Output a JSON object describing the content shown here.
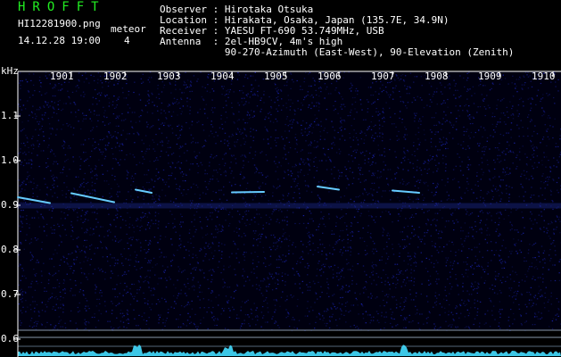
{
  "app": {
    "title": "HROFFT"
  },
  "file": {
    "name": "HI12281900.png",
    "datetime": "14.12.28 19:00"
  },
  "meteor": {
    "label": "meteor",
    "count": "4"
  },
  "info": {
    "observer": "Observer : Hirotaka Otsuka",
    "location": "Location : Hirakata, Osaka, Japan (135.7E, 34.9N)",
    "receiver": "Receiver : YAESU FT-690 53.749MHz, USB",
    "antenna": "Antenna  : 2el-HB9CV, 4m's high",
    "antenna2": "           90-270-Azimuth (East-West), 90-Elevation (Zenith)"
  },
  "axis": {
    "unit": "kHz",
    "x_labels": [
      "1901",
      "1902",
      "1903",
      "1904",
      "1905",
      "1906",
      "1907",
      "1908",
      "1909",
      "1910"
    ],
    "y_labels": [
      "1.1",
      "1.0",
      "0.9",
      "0.8",
      "0.7",
      "0.6"
    ]
  },
  "colors": {
    "accent": "#22ee22",
    "background": "#000000",
    "noise": "#1a22aa",
    "echo": "#66ccff",
    "baseline": "#44ddff"
  },
  "chart_data": {
    "type": "heatmap",
    "ylabel": "kHz",
    "x": [
      "1901",
      "1902",
      "1903",
      "1904",
      "1905",
      "1906",
      "1907",
      "1908",
      "1909",
      "1910"
    ],
    "y_ticks": [
      1.1,
      1.0,
      0.9,
      0.8,
      0.7,
      0.6
    ],
    "meteor_echoes": [
      {
        "start_min": 1900.0,
        "end_min": 1900.6,
        "khz_start": 0.918,
        "khz_end": 0.905
      },
      {
        "start_min": 1901.0,
        "end_min": 1901.8,
        "khz_start": 0.927,
        "khz_end": 0.907
      },
      {
        "start_min": 1902.2,
        "end_min": 1902.5,
        "khz_start": 0.935,
        "khz_end": 0.928
      },
      {
        "start_min": 1904.0,
        "end_min": 1904.6,
        "khz_start": 0.929,
        "khz_end": 0.93
      },
      {
        "start_min": 1905.6,
        "end_min": 1906.0,
        "khz_start": 0.942,
        "khz_end": 0.935
      },
      {
        "start_min": 1907.0,
        "end_min": 1907.5,
        "khz_start": 0.933,
        "khz_end": 0.928
      }
    ]
  }
}
